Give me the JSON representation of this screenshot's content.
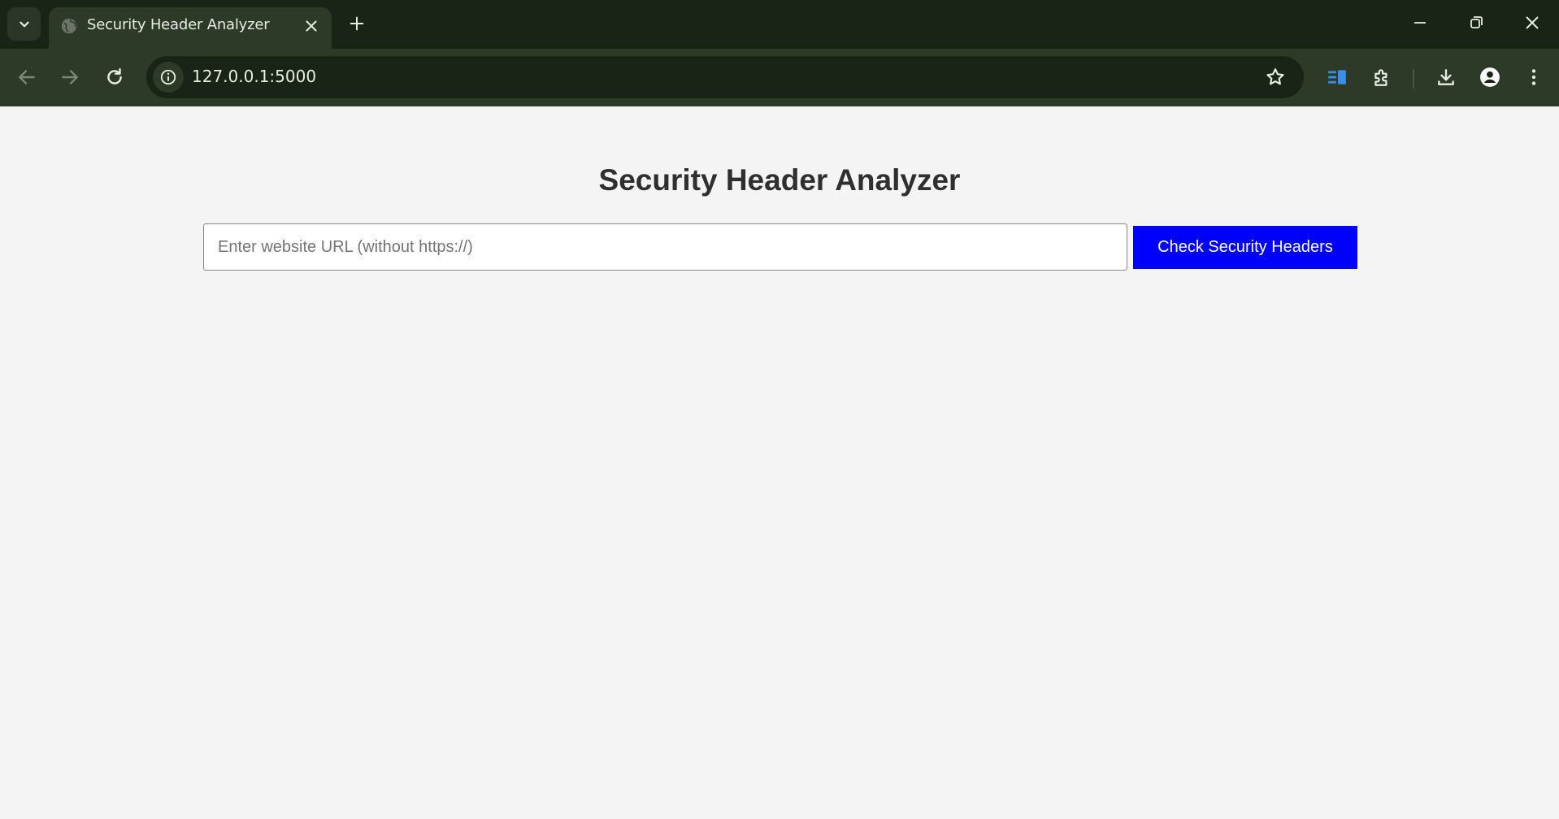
{
  "browser": {
    "tab": {
      "title": "Security Header Analyzer"
    },
    "address_bar": {
      "url": "127.0.0.1:5000"
    },
    "icons": {
      "tab_search": "chevron-down-icon",
      "favicon": "globe-icon",
      "tab_close": "close-icon",
      "new_tab": "plus-icon",
      "minimize": "minimize-icon",
      "restore": "restore-icon",
      "close_window": "close-icon",
      "back": "arrow-left-icon",
      "forward": "arrow-right-icon",
      "reload": "reload-icon",
      "site_info": "info-icon",
      "bookmark": "star-icon",
      "reading_list": "side-panel-icon",
      "extensions": "puzzle-icon",
      "downloads": "download-icon",
      "profile": "person-icon",
      "menu": "more-vert-icon"
    }
  },
  "page": {
    "title": "Security Header Analyzer",
    "search": {
      "placeholder": "Enter website URL (without https://)",
      "value": "",
      "button_label": "Check Security Headers"
    }
  },
  "colors": {
    "chrome_dark": "#1a2416",
    "chrome_toolbar": "#2d3a27",
    "page_bg": "#f4f4f4",
    "button_bg": "#0000ff",
    "button_text": "#ffffff",
    "heading_text": "#2f2f2f",
    "side_panel_accent": "#3b8eea"
  }
}
